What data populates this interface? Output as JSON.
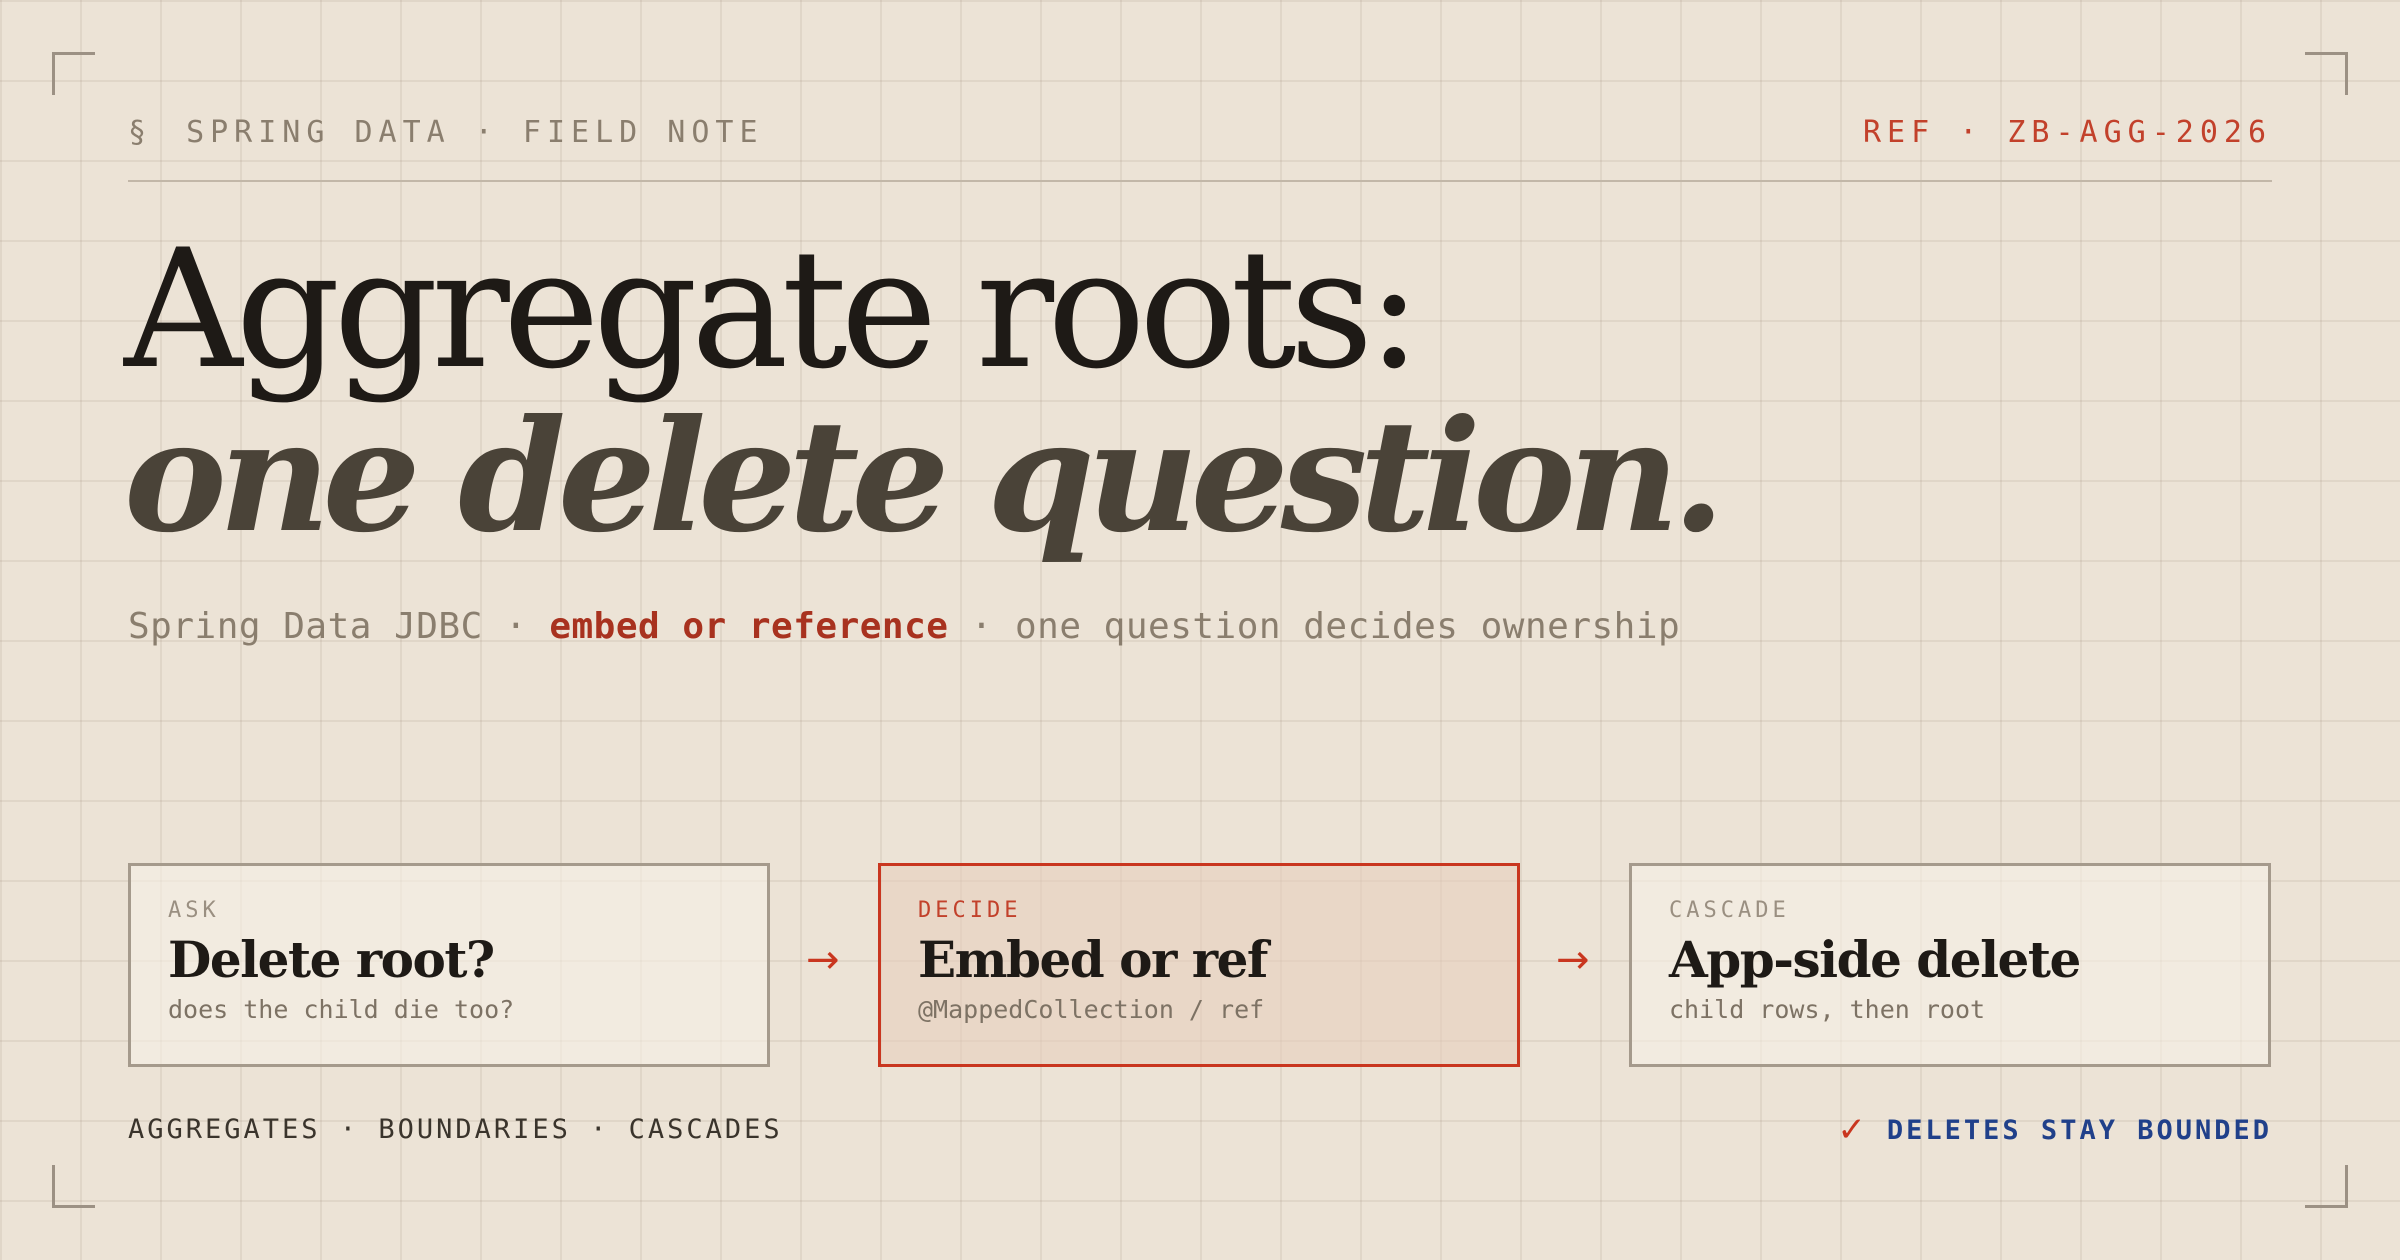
{
  "header": {
    "section_mark": "§",
    "label": "SPRING DATA · FIELD NOTE",
    "ref": "REF · ZB-AGG-2026"
  },
  "title": {
    "line1": "Aggregate roots:",
    "line2": "one delete question."
  },
  "subtitle": {
    "prefix": "Spring Data JDBC · ",
    "highlight": "embed or reference",
    "suffix": " · one question decides ownership"
  },
  "steps": [
    {
      "tag": "ASK",
      "title": "Delete root?",
      "desc": "does the child die too?"
    },
    {
      "tag": "DECIDE",
      "title": "Embed or ref",
      "desc": "@MappedCollection / ref"
    },
    {
      "tag": "CASCADE",
      "title": "App-side delete",
      "desc": "child rows, then root"
    }
  ],
  "arrow_glyph": "→",
  "footer": {
    "left": "AGGREGATES · BOUNDARIES · CASCADES",
    "check_glyph": "✓",
    "right": "DELETES STAY BOUNDED"
  },
  "colors": {
    "background": "#ece3d6",
    "accent_red": "#c9361f",
    "accent_blue": "#20408a",
    "ink": "#1e1a16"
  }
}
